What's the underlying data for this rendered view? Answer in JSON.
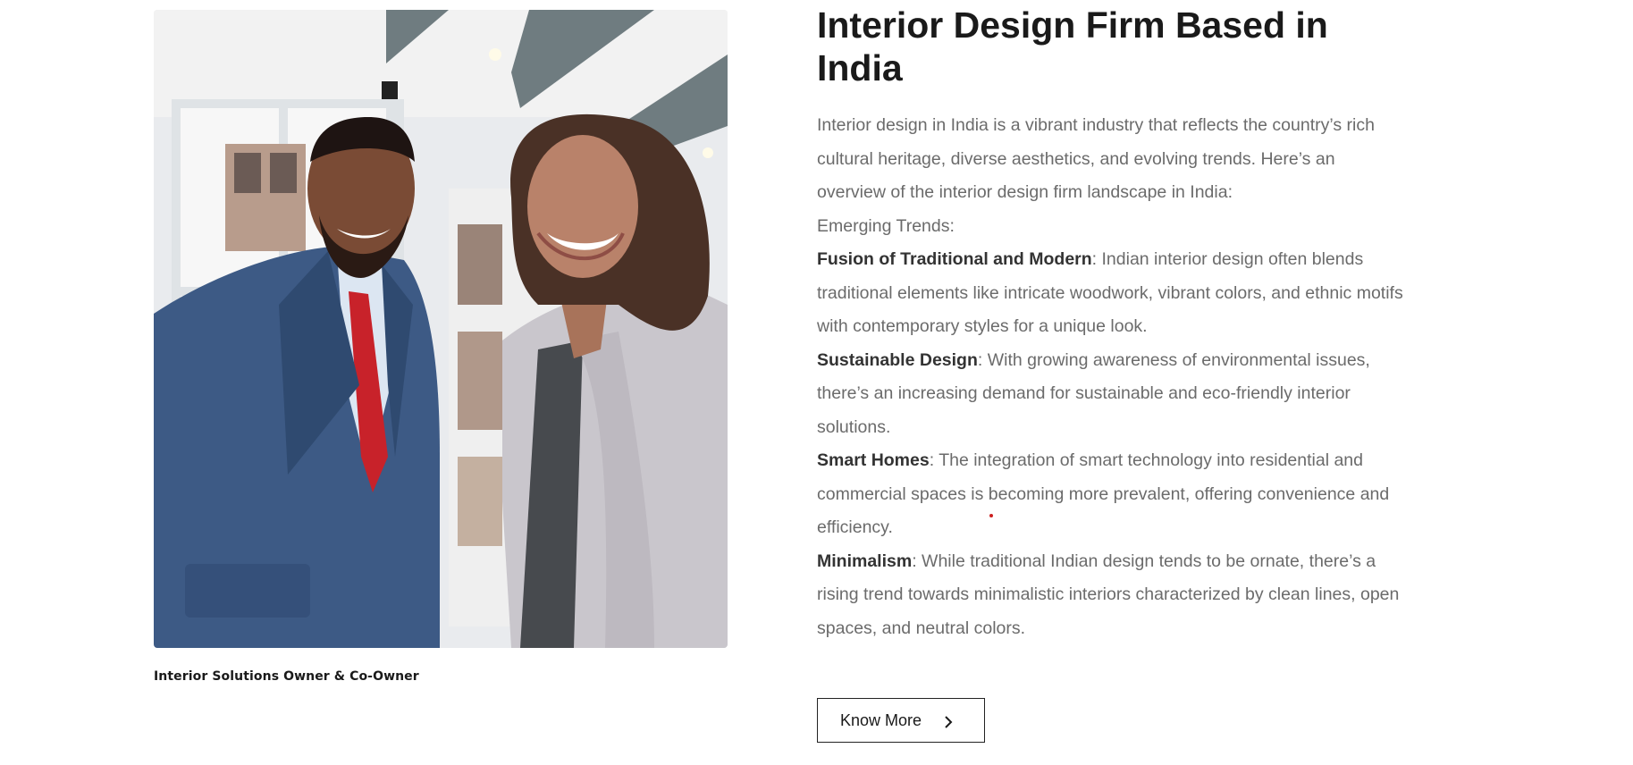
{
  "photo": {
    "alt": "Interior Solutions Owner and Co-Owner portrait"
  },
  "caption": "Interior Solutions Owner & Co-Owner",
  "heading": "Interior Design Firm Based in India",
  "intro": "Interior design in India is a vibrant industry that reflects the country’s rich cultural heritage, diverse aesthetics, and evolving trends. Here’s an overview of the interior design firm landscape in India:",
  "trends_heading": "Emerging Trends:",
  "trends": [
    {
      "title": "Fusion of Traditional and Modern",
      "text": ": Indian interior design often blends traditional elements like intricate woodwork, vibrant colors, and ethnic motifs with contemporary styles for a unique look."
    },
    {
      "title": "Sustainable Design",
      "text": ": With growing awareness of environmental issues, there’s an increasing demand for sustainable and eco-friendly interior solutions."
    },
    {
      "title": "Smart Homes",
      "text": ": The integration of smart technology into residential and commercial spaces is becoming more prevalent, offering convenience and efficiency."
    },
    {
      "title": "Minimalism",
      "text": ": While traditional Indian design tends to be ornate, there’s a rising trend towards minimalistic interiors characterized by clean lines, open spaces, and neutral colors."
    }
  ],
  "cta": {
    "label": "Know More",
    "icon": "chevron-right-icon"
  },
  "colors": {
    "heading": "#1a1a1a",
    "body_text": "#6b6b6b",
    "bold_text": "#333333",
    "button_border": "#222222",
    "accent_dot": "#cc1f1f"
  }
}
